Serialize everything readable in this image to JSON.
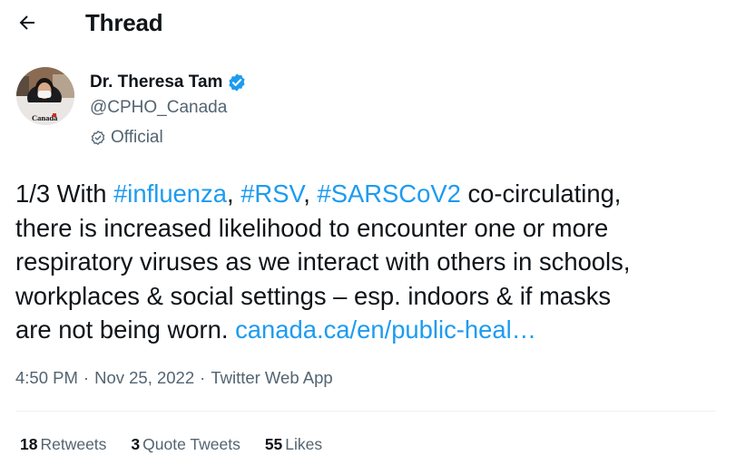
{
  "header": {
    "title": "Thread",
    "back_icon": "arrow-left-icon"
  },
  "author": {
    "name": "Dr. Theresa Tam",
    "handle": "@CPHO_Canada",
    "label": "Official",
    "avatar_wordmark": "Canadä",
    "verified_color": "#1d9bf0"
  },
  "tweet": {
    "prefix": "1/3 With ",
    "hashtags": [
      "#influenza",
      "#RSV",
      "#SARSCoV2"
    ],
    "sep1": ", ",
    "sep2": ", ",
    "after_tags": " co-circulating,",
    "line2": "there is increased likelihood to encounter one or more",
    "line3": "respiratory viruses as we interact with others in schools,",
    "line4": "workplaces & social settings – esp. indoors & if masks",
    "line5_text": "are not being worn. ",
    "link": "canada.ca/en/public-heal…"
  },
  "meta": {
    "time": "4:50 PM",
    "dot": "·",
    "date": "Nov 25, 2022",
    "app": "Twitter Web App"
  },
  "stats": {
    "retweets": {
      "count": "18",
      "label": "Retweets"
    },
    "quotes": {
      "count": "3",
      "label": "Quote Tweets"
    },
    "likes": {
      "count": "55",
      "label": "Likes"
    }
  },
  "colors": {
    "link": "#1d9bf0",
    "secondary": "#536471",
    "primary": "#0f1419"
  }
}
